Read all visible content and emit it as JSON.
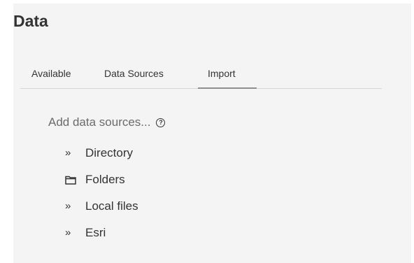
{
  "header": {
    "title": "Data"
  },
  "tabs": [
    {
      "label": "Available",
      "active": false
    },
    {
      "label": "Data Sources",
      "active": false
    },
    {
      "label": "Import",
      "active": true
    }
  ],
  "import": {
    "add_label": "Add data sources...",
    "help_icon": "help-icon",
    "items": [
      {
        "label": "Directory",
        "icon": "double-chevron-right-icon"
      },
      {
        "label": "Folders",
        "icon": "folder-icon"
      },
      {
        "label": "Local files",
        "icon": "double-chevron-right-icon"
      },
      {
        "label": "Esri",
        "icon": "double-chevron-right-icon"
      }
    ]
  },
  "colors": {
    "panel_background": "#f4f4f4",
    "text": "#333333",
    "muted_text": "#6b6b6b",
    "active_tab_underline": "#8f8f8f"
  }
}
